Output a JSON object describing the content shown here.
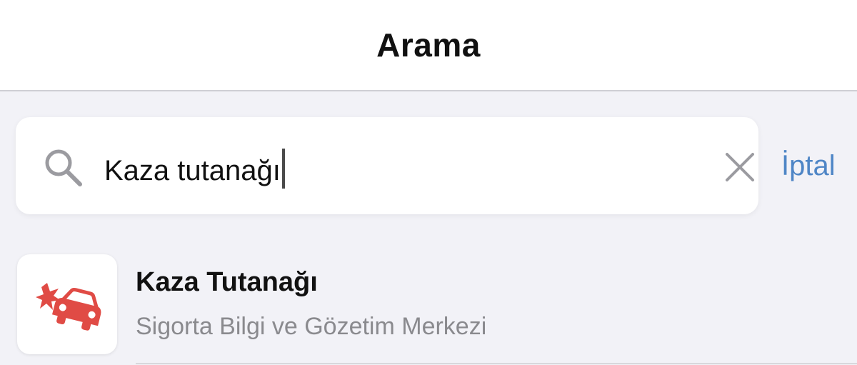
{
  "header": {
    "title": "Arama"
  },
  "search": {
    "query": "Kaza tutanağı",
    "cancel_label": "İptal"
  },
  "results": [
    {
      "title": "Kaza Tutanağı",
      "subtitle": "Sigorta Bilgi ve Gözetim Merkezi",
      "icon": "car-crash-icon",
      "icon_color": "#e04b45"
    }
  ],
  "colors": {
    "accent": "#4f86c6",
    "background": "#f2f2f7",
    "secondary_text": "#8a8a8e"
  }
}
